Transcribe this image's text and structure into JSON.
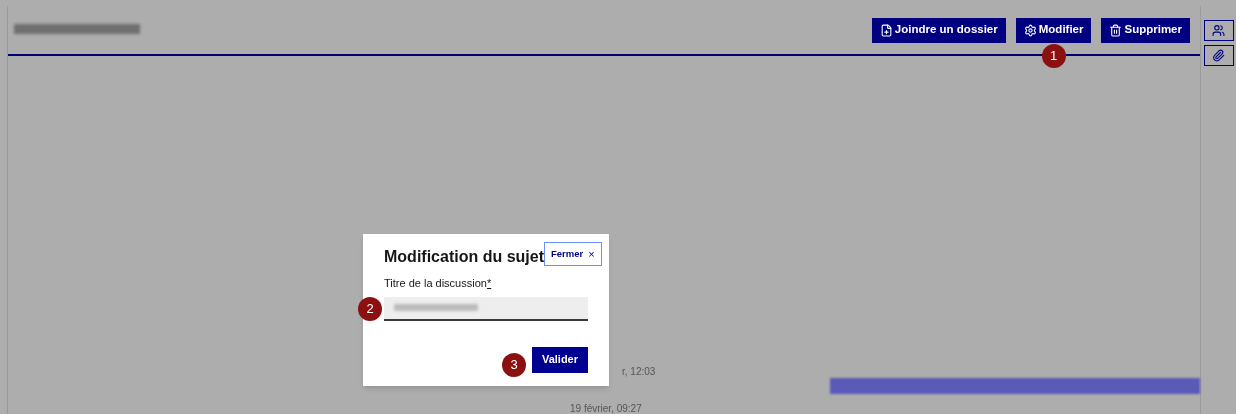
{
  "header": {
    "actions": [
      {
        "label": "Joindre un dossier"
      },
      {
        "label": "Modifier",
        "marker": "1"
      },
      {
        "label": "Supprimer"
      }
    ]
  },
  "dialog": {
    "title": "Modification du sujet",
    "close": "Fermer",
    "close_icon": "×",
    "field_label": "Titre de la discussion",
    "required_mark": "*",
    "field_marker": "2",
    "submit": "Valider",
    "submit_marker": "3"
  },
  "messages": [
    {
      "time": "r, 12:03"
    },
    {
      "time": "19 février, 09:27"
    }
  ]
}
